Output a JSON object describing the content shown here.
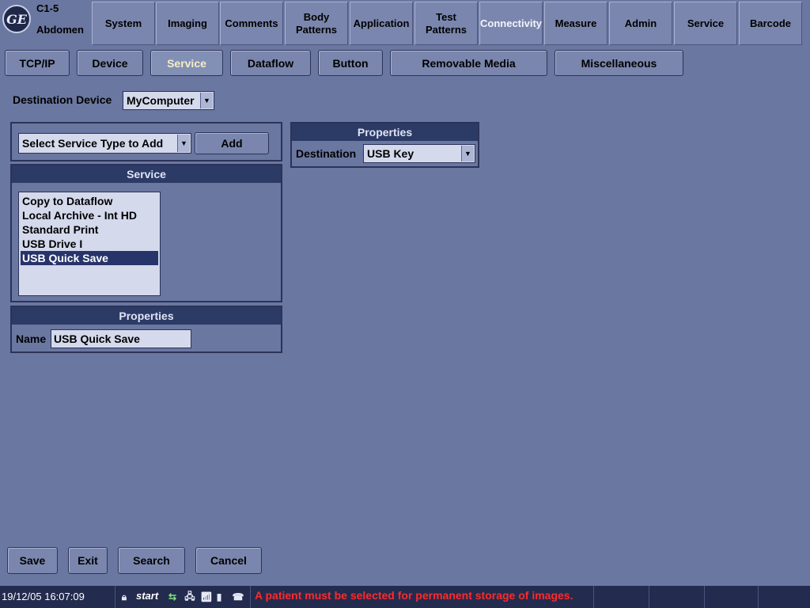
{
  "header": {
    "probe": "C1-5",
    "preset": "Abdomen",
    "logo_text": "GE",
    "tabs": [
      "System",
      "Imaging",
      "Comments",
      "Body\nPatterns",
      "Application",
      "Test\nPatterns",
      "Connectivity",
      "Measure",
      "Admin",
      "Service",
      "Barcode"
    ],
    "active_tab": "Connectivity"
  },
  "subtabs": {
    "items": [
      "TCP/IP",
      "Device",
      "Service",
      "Dataflow",
      "Button",
      "Removable Media",
      "Miscellaneous"
    ],
    "active": "Service"
  },
  "destination_device": {
    "label": "Destination Device",
    "value": "MyComputer"
  },
  "add_service": {
    "select_value": "Select Service Type to Add",
    "add_label": "Add"
  },
  "service_panel": {
    "title": "Service",
    "items": [
      "Copy to Dataflow",
      "Local Archive - Int HD",
      "Standard Print",
      "USB Drive I",
      "USB Quick Save"
    ],
    "selected": "USB Quick Save"
  },
  "properties_left": {
    "title": "Properties",
    "name_label": "Name",
    "name_value": "USB Quick Save"
  },
  "properties_right": {
    "title": "Properties",
    "destination_label": "Destination",
    "destination_value": "USB Key"
  },
  "bottom_buttons": {
    "save": "Save",
    "exit": "Exit",
    "search": "Search",
    "cancel": "Cancel"
  },
  "statusbar": {
    "datetime": "19/12/05 16:07:09",
    "start": "start",
    "message": "A patient must be selected for permanent storage of images.",
    "message_color": "#ff2a2a",
    "icons": [
      "lock-icon",
      "dataflow-icon",
      "network-disconnected-icon",
      "network-wireless-icon",
      "battery-icon",
      "phone-icon"
    ]
  },
  "colors": {
    "background": "#6a77a0",
    "panel_header": "#2c3a66",
    "selection": "#27346a",
    "active_tab_text": "#f2f4ff",
    "active_subtab_text": "#f4edc4"
  }
}
